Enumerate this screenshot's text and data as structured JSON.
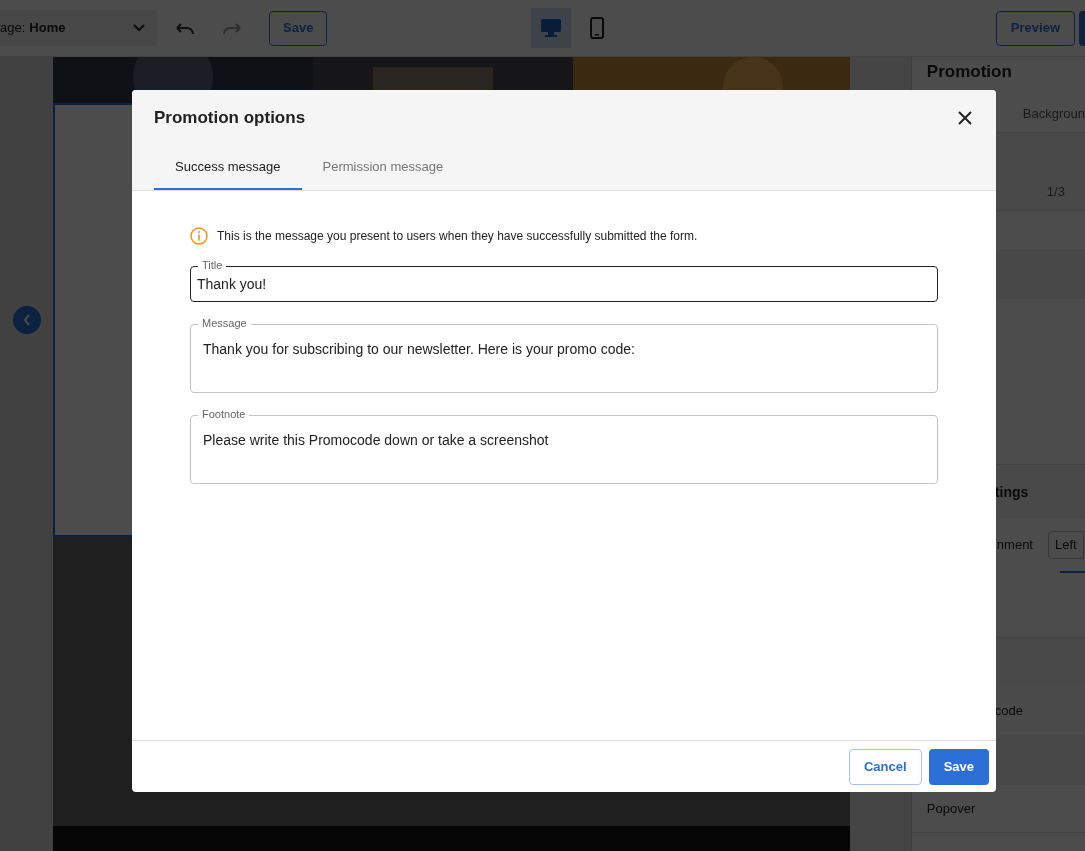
{
  "toolbar": {
    "page_label": "age:",
    "page_value": "Home",
    "save": "Save",
    "devices": [
      {
        "kind": "desktop",
        "selected": true
      },
      {
        "kind": "mobile",
        "selected": false
      }
    ],
    "preview": "Preview"
  },
  "side_panel": {
    "title": "Promotion",
    "tab": "Backgroun",
    "counter": "1/3",
    "section": "tings",
    "alignment_label": "nment",
    "alignment_value": "Left",
    "item": "code",
    "popover": "Popover"
  },
  "dialog": {
    "title": "Promotion options",
    "tabs": [
      {
        "label": "Success message",
        "selected": true
      },
      {
        "label": "Permission message",
        "selected": false
      }
    ],
    "info": "This is the message you present to users when they have successfully submitted the form.",
    "fields": [
      {
        "label": "Title",
        "value": "Thank you!",
        "focused": true,
        "kind": "single"
      },
      {
        "label": "Message",
        "value": "Thank you for subscribing to our newsletter. Here is your promo code:",
        "focused": false,
        "kind": "multi"
      },
      {
        "label": "Footnote",
        "value": "Please write this Promocode down or take a screenshot",
        "focused": false,
        "kind": "multi"
      }
    ],
    "buttons": [
      {
        "label": "Cancel",
        "kind": "secondary"
      },
      {
        "label": "Save",
        "kind": "primary"
      }
    ]
  }
}
